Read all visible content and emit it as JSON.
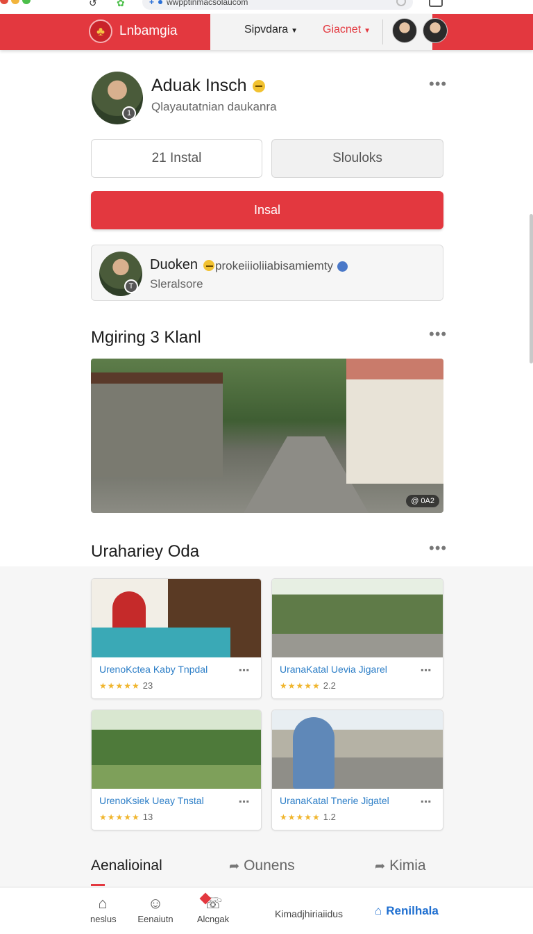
{
  "browser": {
    "url": "wwpptinmacsolaucom"
  },
  "header": {
    "brand": "Lnbamgia",
    "nav_1": "Sipvdara",
    "nav_2": "Giacnet",
    "colors": {
      "brand_red": "#e3383f"
    }
  },
  "profile": {
    "name": "Aduak Insch",
    "subtitle": "Qlayautatnian daukanra",
    "avatar_badge": "1"
  },
  "actions": {
    "install_count": "21 Instal",
    "secondary": "Slouloks",
    "primary": "Insal"
  },
  "owner": {
    "name": "Duoken",
    "handle": "prokeiiioliiabisamiemty",
    "status": "Sleralsore",
    "badge": "T"
  },
  "gallery": {
    "title": "Mgiring 3 Klanl",
    "counter": "@ 0A2"
  },
  "related": {
    "title": "Urahariey Oda",
    "items": [
      {
        "title": "UrenoKctea Kaby Tnpdal",
        "stars": "★★★★★",
        "rating": "23"
      },
      {
        "title": "UranaKatal Uevia Jigarel",
        "stars": "★★★★★",
        "rating": "2.2"
      },
      {
        "title": "UrenoKsiek Ueay Tnstal",
        "stars": "★★★★★",
        "rating": "13"
      },
      {
        "title": "UranaKatal Tnerie Jigatel",
        "stars": "★★★★★",
        "rating": "1.2"
      }
    ]
  },
  "tabs": {
    "tab_1": "Aenalioinal",
    "tab_2": "Ounens",
    "tab_3": "Kimia"
  },
  "bottom_nav": {
    "item_1": "neslus",
    "item_2": "Eenaiutn",
    "item_3": "Alcngak",
    "center": "Kimadjhiriaiidus",
    "active": "Renilhala"
  }
}
